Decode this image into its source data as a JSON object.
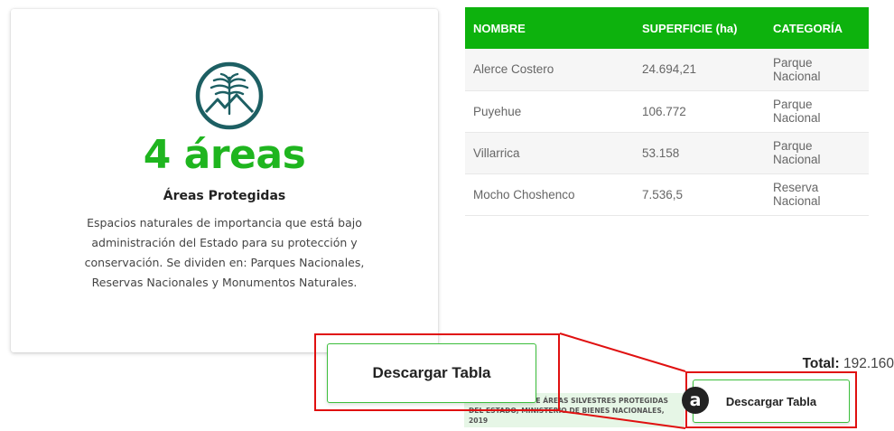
{
  "card": {
    "icon": "araucaria-mountain-icon",
    "count": "4 áreas",
    "title": "Áreas Protegidas",
    "description": "Espacios naturales de importancia que está bajo administración del Estado para su protección y conservación. Se dividen en: Parques Nacionales, Reservas Nacionales y Monumentos Naturales."
  },
  "table": {
    "headers": [
      "NOMBRE",
      "SUPERFICIE (ha)",
      "CATEGORÍA"
    ],
    "rows": [
      [
        "Alerce Costero",
        "24.694,21",
        "Parque Nacional"
      ],
      [
        "Puyehue",
        "106.772",
        "Parque Nacional"
      ],
      [
        "Villarrica",
        "53.158",
        "Parque Nacional"
      ],
      [
        "Mocho Choshenco",
        "7.536,5",
        "Reserva Nacional"
      ]
    ]
  },
  "total": {
    "label": "Total:",
    "value": "192.160"
  },
  "source": "EMA NACIONAL DE ÁREAS SILVESTRES PROTEGIDAS DEL ESTADO, MINISTERIO DE BIENES NACIONALES, 2019",
  "download_button": {
    "label": "Descargar Tabla"
  },
  "callout": {
    "badge": "a"
  },
  "colors": {
    "accent_green": "#1fb51f",
    "header_green": "#0db20d",
    "callout_red": "#e01010"
  }
}
